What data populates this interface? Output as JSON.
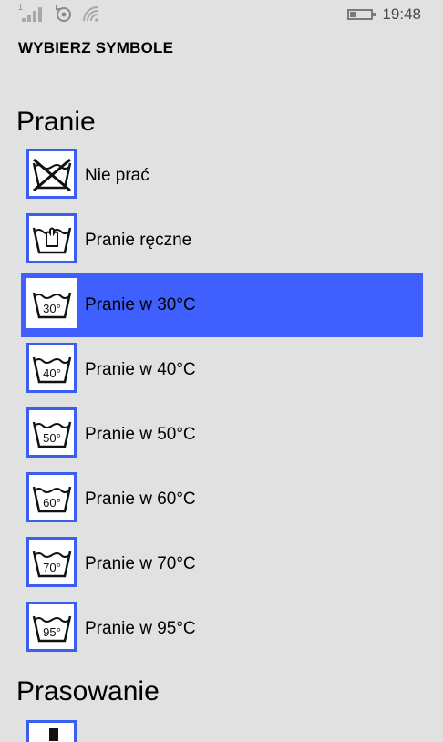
{
  "status_bar": {
    "sim_number": "1",
    "time": "19:48",
    "battery_level": 0.3
  },
  "app": {
    "title": "WYBIERZ SYMBOLE"
  },
  "sections": [
    {
      "header": "Pranie",
      "items": [
        {
          "label": "Nie prać",
          "icon": "do-not-wash-icon",
          "temp": "",
          "selected": false
        },
        {
          "label": "Pranie ręczne",
          "icon": "hand-wash-icon",
          "temp": "",
          "selected": false
        },
        {
          "label": "Pranie w 30°C",
          "icon": "wash-30-icon",
          "temp": "30°",
          "selected": true
        },
        {
          "label": "Pranie w 40°C",
          "icon": "wash-40-icon",
          "temp": "40°",
          "selected": false
        },
        {
          "label": "Pranie w 50°C",
          "icon": "wash-50-icon",
          "temp": "50°",
          "selected": false
        },
        {
          "label": "Pranie w 60°C",
          "icon": "wash-60-icon",
          "temp": "60°",
          "selected": false
        },
        {
          "label": "Pranie w 70°C",
          "icon": "wash-70-icon",
          "temp": "70°",
          "selected": false
        },
        {
          "label": "Pranie w 95°C",
          "icon": "wash-95-icon",
          "temp": "95°",
          "selected": false
        }
      ]
    },
    {
      "header": "Prasowanie",
      "items": []
    }
  ],
  "colors": {
    "background": "#e1e1e1",
    "accent": "#3f60ff",
    "icon_border": "#3a5ef0"
  }
}
